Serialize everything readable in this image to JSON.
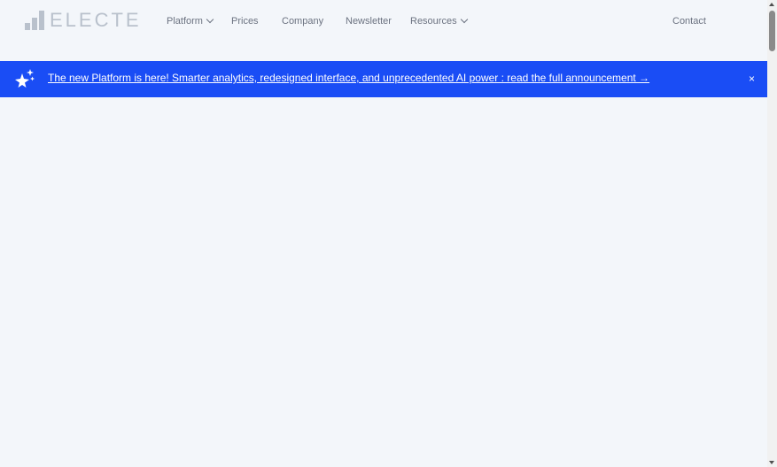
{
  "header": {
    "logo_text": "ELECTE",
    "logo_icon": "bar-chart-logo-icon",
    "nav": [
      {
        "label": "Platform",
        "has_dropdown": true
      },
      {
        "label": "Prices",
        "has_dropdown": false
      },
      {
        "label": "Company",
        "has_dropdown": false
      },
      {
        "label": "Newsletter",
        "has_dropdown": false
      },
      {
        "label": "Resources",
        "has_dropdown": true
      }
    ],
    "contact_label": "Contact"
  },
  "banner": {
    "icon": "sparkles-star-icon",
    "text": "The new Platform is here! Smarter analytics, redesigned interface, and unprecedented AI power : read the full announcement →",
    "close_label": "×"
  },
  "colors": {
    "page_background": "#f3f6fa",
    "banner_background": "#1a4df5",
    "banner_text": "#ffffff",
    "nav_text": "#6b7280",
    "logo": "#b9c1cc"
  }
}
